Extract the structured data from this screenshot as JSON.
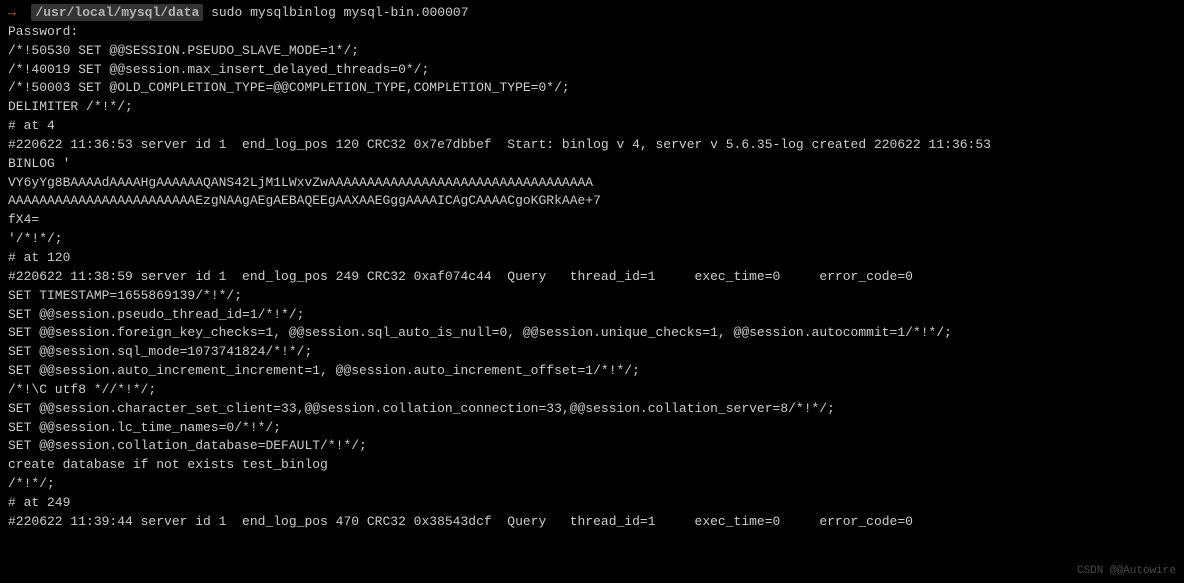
{
  "prompt": {
    "arrow": "→",
    "path": "/usr/local/mysql/data",
    "command": "sudo mysqlbinlog mysql-bin.000007"
  },
  "lines": [
    "Password:",
    "/*!50530 SET @@SESSION.PSEUDO_SLAVE_MODE=1*/;",
    "/*!40019 SET @@session.max_insert_delayed_threads=0*/;",
    "/*!50003 SET @OLD_COMPLETION_TYPE=@@COMPLETION_TYPE,COMPLETION_TYPE=0*/;",
    "DELIMITER /*!*/;",
    "# at 4",
    "#220622 11:36:53 server id 1  end_log_pos 120 CRC32 0x7e7dbbef  Start: binlog v 4, server v 5.6.35-log created 220622 11:36:53",
    "BINLOG '",
    "VY6yYg8BAAAAdAAAAHgAAAAAAQANS42LjM1LWxvZwAAAAAAAAAAAAAAAAAAAAAAAAAAAAAAAAAA",
    "AAAAAAAAAAAAAAAAAAAAAAAAEzgNAAgAEgAEBAQEEgAAXAAEGggAAAAICAgCAAAACgoKGRkAAe+7",
    "fX4=",
    "'/*!*/;",
    "# at 120",
    "#220622 11:38:59 server id 1  end_log_pos 249 CRC32 0xaf074c44  Query   thread_id=1     exec_time=0     error_code=0",
    "SET TIMESTAMP=1655869139/*!*/;",
    "SET @@session.pseudo_thread_id=1/*!*/;",
    "SET @@session.foreign_key_checks=1, @@session.sql_auto_is_null=0, @@session.unique_checks=1, @@session.autocommit=1/*!*/;",
    "SET @@session.sql_mode=1073741824/*!*/;",
    "SET @@session.auto_increment_increment=1, @@session.auto_increment_offset=1/*!*/;",
    "/*!\\C utf8 *//*!*/;",
    "SET @@session.character_set_client=33,@@session.collation_connection=33,@@session.collation_server=8/*!*/;",
    "SET @@session.lc_time_names=0/*!*/;",
    "SET @@session.collation_database=DEFAULT/*!*/;",
    "create database if not exists test_binlog",
    "/*!*/;",
    "# at 249",
    "#220622 11:39:44 server id 1  end_log_pos 470 CRC32 0x38543dcf  Query   thread_id=1     exec_time=0     error_code=0"
  ],
  "watermark": "CSDN @@Autowire"
}
